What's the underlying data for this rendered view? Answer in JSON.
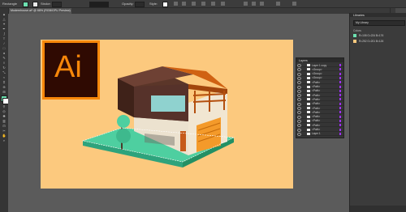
{
  "control_bar": {
    "selection_label": "Rectangle",
    "stroke_label": "Stroke:",
    "opacity_label": "Opacity:",
    "style_label": "Style:",
    "fill_color": "#6ce0b0",
    "stroke_color": "#e8e8e8"
  },
  "document_tab": {
    "title": "Modernhouse.ai* @ 68% (RGB/GPU Preview)"
  },
  "toolbar": {
    "fill_color": "#6ce0b0",
    "stroke_color": "#ffffff"
  },
  "canvas": {
    "artboard_color": "#fcc97e",
    "logo_text": "Ai"
  },
  "layers_panel": {
    "title": "Layers",
    "rows": [
      {
        "label": "Layer 1 copy"
      },
      {
        "label": "<Group>"
      },
      {
        "label": "<Group>"
      },
      {
        "label": "<Group>"
      },
      {
        "label": "<Path>"
      },
      {
        "label": "<Path>"
      },
      {
        "label": "<Path>"
      },
      {
        "label": "<Path>"
      },
      {
        "label": "<Path>"
      },
      {
        "label": "<Path>"
      },
      {
        "label": "<Path>"
      },
      {
        "label": "<Path>"
      },
      {
        "label": "<Path>"
      },
      {
        "label": "<Path>"
      },
      {
        "label": "<Path>"
      },
      {
        "label": "<Path>"
      },
      {
        "label": "Layer 1"
      }
    ]
  },
  "libraries_panel": {
    "title": "Libraries",
    "library_name": "My Library",
    "section": "Colors",
    "colors": [
      {
        "hex": "#6ce0b0",
        "label": "R=108 G=224 B=176"
      },
      {
        "hex": "#fcc97e",
        "label": "R=252 G=201 B=126"
      }
    ]
  }
}
